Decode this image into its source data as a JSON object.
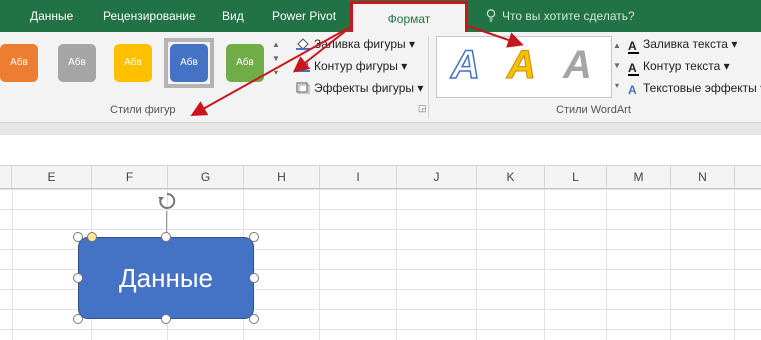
{
  "tabs": [
    "Данные",
    "Рецензирование",
    "Вид",
    "Power Pivot"
  ],
  "active_tab": "Формат",
  "search_placeholder": "Что вы хотите сделать?",
  "shape_styles": {
    "swatch_label": "Абв",
    "swatch_colors": [
      "#ed7d31",
      "#a5a5a5",
      "#ffc000",
      "#4472c4",
      "#70ad47"
    ],
    "commands": [
      "Заливка фигуры",
      "Контур фигуры",
      "Эффекты фигуры"
    ],
    "group_label": "Стили фигур"
  },
  "wordart": {
    "letter": "A",
    "commands": [
      "Заливка текста",
      "Контур текста",
      "Текстовые эффекты"
    ],
    "group_label": "Стили WordArt"
  },
  "columns": [
    "E",
    "F",
    "G",
    "H",
    "I",
    "J",
    "K",
    "L",
    "M",
    "N"
  ],
  "shape": {
    "text": "Данные",
    "fill": "#4472c4"
  },
  "colors": {
    "accent": "#217346",
    "highlight": "#c8161d"
  }
}
